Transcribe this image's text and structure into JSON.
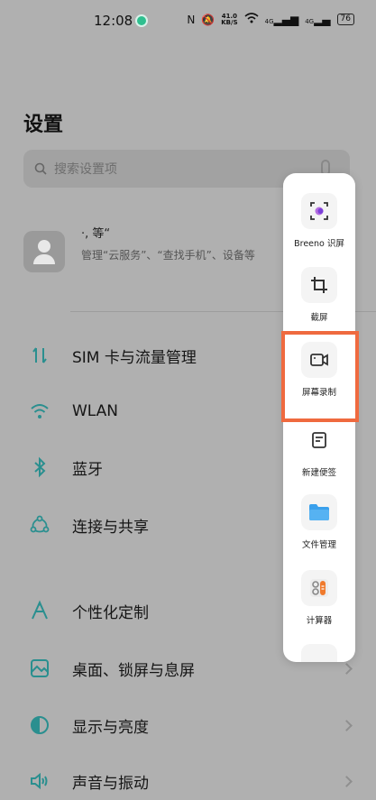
{
  "status_bar": {
    "time": "12:08",
    "speed_value": "41.0",
    "speed_unit": "KB/S",
    "sig1": "4G",
    "sig2": "4G",
    "battery": "76"
  },
  "page": {
    "title": "设置",
    "search_placeholder": "搜索设置项"
  },
  "account": {
    "name": "·, 等“",
    "desc": "管理“云服务”、“查找手机”、设备等"
  },
  "menu": [
    {
      "label": "SIM 卡与流量管理",
      "icon": "sim-data-icon"
    },
    {
      "label": "WLAN",
      "icon": "wifi-icon"
    },
    {
      "label": "蓝牙",
      "icon": "bluetooth-icon"
    },
    {
      "label": "连接与共享",
      "icon": "share-icon"
    },
    {
      "label": "个性化定制",
      "icon": "personalize-icon"
    },
    {
      "label": "桌面、锁屏与息屏",
      "icon": "wallpaper-icon"
    },
    {
      "label": "显示与亮度",
      "icon": "display-icon"
    },
    {
      "label": "声音与振动",
      "icon": "sound-icon"
    }
  ],
  "sidebar": [
    {
      "label": "Breeno 识屏",
      "icon": "breeno-icon"
    },
    {
      "label": "截屏",
      "icon": "crop-icon"
    },
    {
      "label": "屏幕录制",
      "icon": "screen-record-icon"
    },
    {
      "label": "新建便签",
      "icon": "note-icon"
    },
    {
      "label": "文件管理",
      "icon": "folder-icon"
    },
    {
      "label": "计算器",
      "icon": "calculator-icon"
    }
  ],
  "colors": {
    "accent": "#2a8f8f",
    "highlight": "#ef6a3f",
    "folder": "#3aa0ec",
    "calculator": "#f07a2c"
  }
}
